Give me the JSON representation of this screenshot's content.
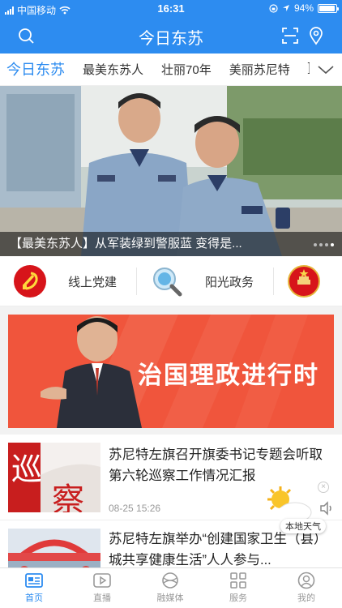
{
  "status": {
    "carrier": "中国移动",
    "time": "16:31",
    "battery": "94%",
    "battery_level": 0.94
  },
  "header": {
    "title": "今日东苏",
    "search_icon": "search-icon",
    "scan_icon": "scan-icon",
    "location_icon": "location-pin-icon"
  },
  "tabs": {
    "items": [
      {
        "label": "今日东苏",
        "active": true
      },
      {
        "label": "最美东苏人"
      },
      {
        "label": "壮丽70年"
      },
      {
        "label": "美丽苏尼特"
      },
      {
        "label": "]"
      }
    ],
    "more_icon": "chevron-down-icon"
  },
  "hero": {
    "caption": "【最美东苏人】从军装绿到警服蓝 变得是...",
    "slide_count": 4,
    "active_slide": 4
  },
  "quick": {
    "items": [
      {
        "label": "线上党建",
        "icon": "party-emblem-icon"
      },
      {
        "label": "阳光政务",
        "icon": "magnifier-icon"
      },
      {
        "label": "",
        "icon": "national-emblem-icon"
      }
    ]
  },
  "banner": {
    "text": "治国理政进行时",
    "color": "#f0553c"
  },
  "news": [
    {
      "title": "苏尼特左旗召开旗委书记专题会听取第六轮巡察工作情况汇报",
      "time": "08-25 15:26",
      "thumb_text_1": "巡",
      "thumb_text_2": "察"
    },
    {
      "title": "苏尼特左旗举办“创建国家卫生（县）城共享健康生活”人人参与...",
      "time": ""
    }
  ],
  "weather": {
    "label": "本地天气",
    "close": "×"
  },
  "bottom_nav": {
    "items": [
      {
        "label": "首页",
        "icon": "home-icon",
        "active": true
      },
      {
        "label": "直播",
        "icon": "play-icon"
      },
      {
        "label": "融媒体",
        "icon": "media-icon"
      },
      {
        "label": "服务",
        "icon": "grid-icon"
      },
      {
        "label": "我的",
        "icon": "user-icon"
      }
    ]
  },
  "colors": {
    "accent": "#2d8cf0",
    "party_red": "#d7141a"
  }
}
